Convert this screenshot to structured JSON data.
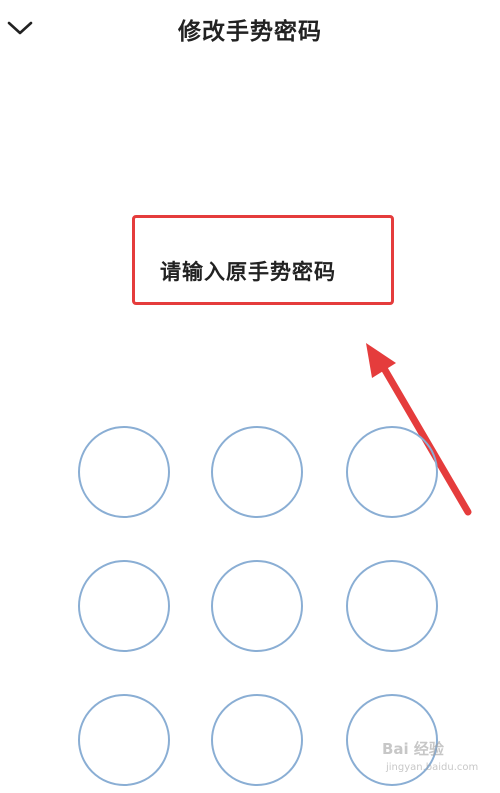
{
  "header": {
    "title": "修改手势密码",
    "back_icon": "chevron-down-icon"
  },
  "prompt": {
    "text": "请输入原手势密码"
  },
  "annotation": {
    "box_color": "#e53c3c",
    "arrow_color": "#e53c3c"
  },
  "gesture_grid": {
    "rows": 3,
    "columns": 3,
    "dot_color": "#8aaed4"
  },
  "watermark": {
    "main": "Bai 经验",
    "sub": "jingyan.baidu.com"
  }
}
